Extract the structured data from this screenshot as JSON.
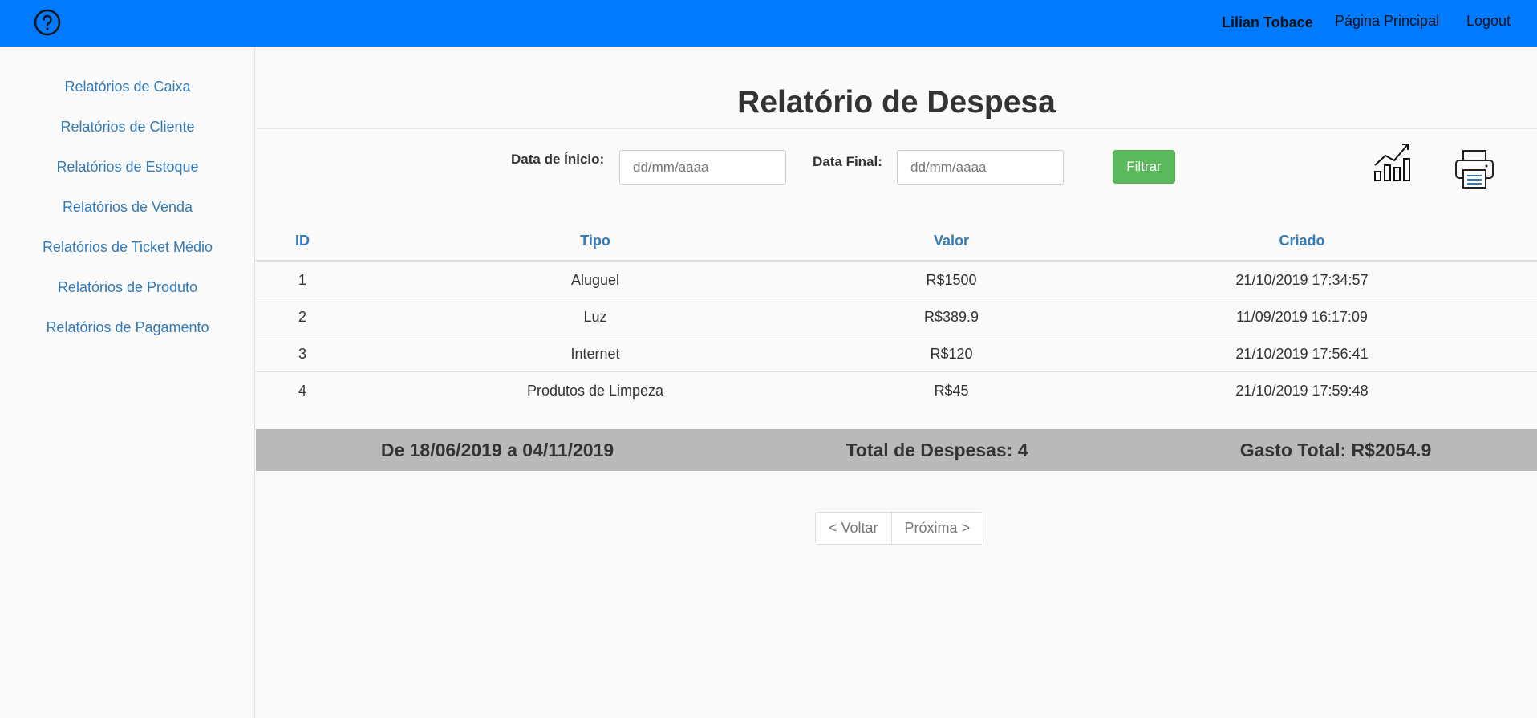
{
  "navbar": {
    "help_icon": "question-circle-icon",
    "user_name": "Lilian Tobace",
    "home_label": "Página Principal",
    "logout_label": "Logout",
    "background_color": "#007bff"
  },
  "sidebar": {
    "items": [
      {
        "label": "Relatórios de Caixa"
      },
      {
        "label": "Relatórios de Cliente"
      },
      {
        "label": "Relatórios de Estoque"
      },
      {
        "label": "Relatórios de Venda"
      },
      {
        "label": "Relatórios de Ticket Médio"
      },
      {
        "label": "Relatórios de Produto"
      },
      {
        "label": "Relatórios de Pagamento"
      }
    ],
    "link_color": "#337ab7"
  },
  "page": {
    "title": "Relatório de Despesa"
  },
  "filter": {
    "start_label": "Data de Ínicio:",
    "start_placeholder": "dd/mm/aaaa",
    "end_label": "Data Final:",
    "end_placeholder": "dd/mm/aaaa",
    "button_label": "Filtrar",
    "button_color": "#5cb85c",
    "chart_icon": "chart-trend-up-icon",
    "print_icon": "printer-icon"
  },
  "table": {
    "columns": [
      "ID",
      "Tipo",
      "Valor",
      "Criado"
    ],
    "rows": [
      [
        "1",
        "Aluguel",
        "R$1500",
        "21/10/2019 17:34:57"
      ],
      [
        "2",
        "Luz",
        "R$389.9",
        "11/09/2019 16:17:09"
      ],
      [
        "3",
        "Internet",
        "R$120",
        "21/10/2019 17:56:41"
      ],
      [
        "4",
        "Produtos de Limpeza",
        "R$45",
        "21/10/2019 17:59:48"
      ]
    ]
  },
  "summary": {
    "period": "De 18/06/2019 a 04/11/2019",
    "total_count": "Total de Despesas: 4",
    "total_spent": "Gasto Total: R$2054.9"
  },
  "pagination": {
    "prev_label": "< Voltar",
    "next_label": "Próxima >"
  }
}
